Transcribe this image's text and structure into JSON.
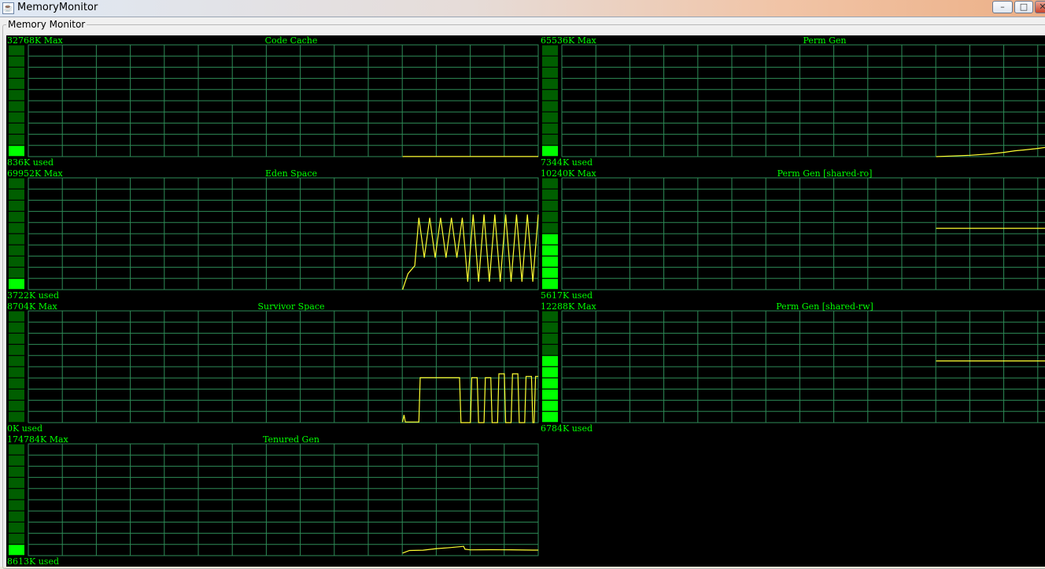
{
  "window": {
    "title": "MemoryMonitor",
    "icon": "java-cup-icon",
    "buttons": {
      "minimize": "–",
      "maximize": "□",
      "close": "✕"
    }
  },
  "panel": {
    "title": "Memory Monitor"
  },
  "colors": {
    "background": "#000000",
    "grid": "#2e8b57",
    "text": "#00ff00",
    "bar_on": "#00ff00",
    "bar_off": "#005e00",
    "line": "#ffff33"
  },
  "chart_data": [
    {
      "type": "line",
      "title": "Code Cache",
      "max_label": "32768K Max",
      "used_label": "836K used",
      "max": 32768,
      "used": 836,
      "samples": [
        [
          0.0,
          0
        ],
        [
          0.01,
          26
        ],
        [
          0.02,
          25
        ],
        [
          0.3,
          25
        ],
        [
          1.0,
          25
        ]
      ]
    },
    {
      "type": "line",
      "title": "Perm Gen",
      "max_label": "65536K Max",
      "used_label": "7344K used",
      "max": 65536,
      "used": 7344,
      "samples": [
        [
          0.0,
          0
        ],
        [
          0.1,
          300
        ],
        [
          0.25,
          800
        ],
        [
          0.4,
          1600
        ],
        [
          0.5,
          2500
        ],
        [
          0.58,
          3400
        ],
        [
          0.65,
          3900
        ],
        [
          0.75,
          4800
        ],
        [
          0.9,
          6400
        ],
        [
          1.0,
          7344
        ]
      ]
    },
    {
      "type": "line",
      "title": "Eden Space",
      "max_label": "69952K Max",
      "used_label": "3722K used",
      "max": 69952,
      "used": 3722,
      "samples": [
        [
          0.0,
          0
        ],
        [
          0.04,
          10000
        ],
        [
          0.09,
          15000
        ],
        [
          0.12,
          45000
        ],
        [
          0.16,
          20000
        ],
        [
          0.2,
          45000
        ],
        [
          0.24,
          20000
        ],
        [
          0.28,
          45000
        ],
        [
          0.32,
          20000
        ],
        [
          0.36,
          45000
        ],
        [
          0.4,
          20000
        ],
        [
          0.44,
          45000
        ],
        [
          0.48,
          5000
        ],
        [
          0.52,
          47000
        ],
        [
          0.56,
          5000
        ],
        [
          0.6,
          47000
        ],
        [
          0.64,
          5000
        ],
        [
          0.68,
          47000
        ],
        [
          0.72,
          5000
        ],
        [
          0.76,
          47000
        ],
        [
          0.8,
          5000
        ],
        [
          0.84,
          47000
        ],
        [
          0.88,
          5000
        ],
        [
          0.92,
          47000
        ],
        [
          0.96,
          5000
        ],
        [
          1.0,
          47000
        ]
      ]
    },
    {
      "type": "line",
      "title": "Perm Gen [shared-ro]",
      "max_label": "10240K Max",
      "used_label": "5617K used",
      "max": 10240,
      "used": 5617,
      "samples": [
        [
          0.0,
          5617
        ],
        [
          1.0,
          5617
        ]
      ]
    },
    {
      "type": "line",
      "title": "Survivor Space",
      "max_label": "8704K Max",
      "used_label": "0K used",
      "max": 8704,
      "used": 0,
      "samples": [
        [
          0.0,
          50
        ],
        [
          0.01,
          600
        ],
        [
          0.02,
          50
        ],
        [
          0.12,
          50
        ],
        [
          0.13,
          3500
        ],
        [
          0.42,
          3500
        ],
        [
          0.43,
          0
        ],
        [
          0.5,
          0
        ],
        [
          0.51,
          3500
        ],
        [
          0.55,
          3500
        ],
        [
          0.56,
          0
        ],
        [
          0.6,
          0
        ],
        [
          0.61,
          3500
        ],
        [
          0.65,
          3500
        ],
        [
          0.66,
          0
        ],
        [
          0.7,
          0
        ],
        [
          0.71,
          3800
        ],
        [
          0.75,
          3800
        ],
        [
          0.76,
          0
        ],
        [
          0.8,
          0
        ],
        [
          0.81,
          3800
        ],
        [
          0.85,
          3800
        ],
        [
          0.86,
          0
        ],
        [
          0.9,
          0
        ],
        [
          0.91,
          3600
        ],
        [
          0.95,
          3600
        ],
        [
          0.96,
          0
        ],
        [
          0.97,
          0
        ],
        [
          0.98,
          3600
        ],
        [
          1.0,
          3600
        ]
      ]
    },
    {
      "type": "line",
      "title": "Perm Gen [shared-rw]",
      "max_label": "12288K Max",
      "used_label": "6784K used",
      "max": 12288,
      "used": 6784,
      "samples": [
        [
          0.0,
          6784
        ],
        [
          1.0,
          6784
        ]
      ]
    },
    {
      "type": "line",
      "title": "Tenured Gen",
      "max_label": "174784K Max",
      "used_label": "8613K used",
      "max": 174784,
      "used": 8613,
      "samples": [
        [
          0.0,
          4000
        ],
        [
          0.05,
          8000
        ],
        [
          0.15,
          8500
        ],
        [
          0.25,
          11000
        ],
        [
          0.35,
          12500
        ],
        [
          0.45,
          14500
        ],
        [
          0.46,
          10000
        ],
        [
          0.5,
          9000
        ],
        [
          0.65,
          9200
        ],
        [
          0.8,
          9100
        ],
        [
          0.96,
          8600
        ],
        [
          1.0,
          8613
        ]
      ]
    }
  ]
}
